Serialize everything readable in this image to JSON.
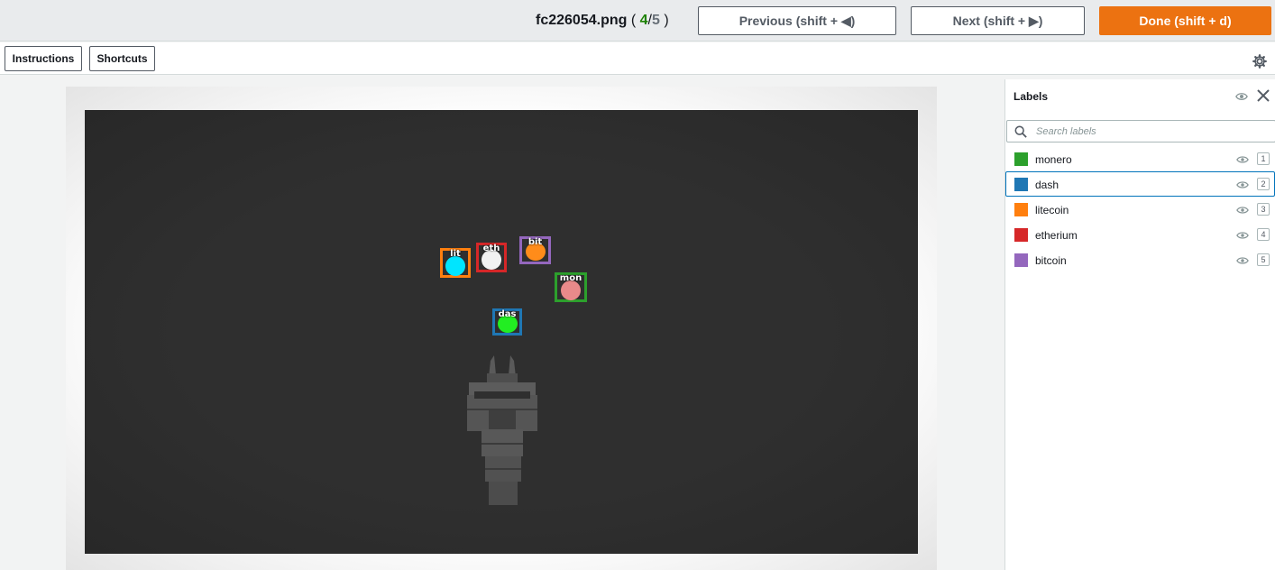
{
  "header": {
    "filename": "fc226054.png",
    "counter_open": " ( ",
    "current_index": "4",
    "slash": "/",
    "total": "5",
    "counter_close": " )",
    "previous_label": "Previous (shift + ◀)",
    "next_label": "Next (shift + ▶)",
    "done_label": "Done (shift + d)"
  },
  "toolbar": {
    "instructions_label": "Instructions",
    "shortcuts_label": "Shortcuts",
    "settings_icon": "gear-icon"
  },
  "canvas": {
    "boxes": [
      {
        "label": "litecoin",
        "text": "lit",
        "box_color": "#ff7f0e",
        "coin_color": "#00e5ff"
      },
      {
        "label": "etherium",
        "text": "eth",
        "box_color": "#d62728",
        "coin_color": "#f2f2f2"
      },
      {
        "label": "bitcoin",
        "text": "bit",
        "box_color": "#9467bd",
        "coin_color": "#ff8c1a"
      },
      {
        "label": "monero",
        "text": "mon",
        "box_color": "#2ca02c",
        "coin_color": "#e88a8a"
      },
      {
        "label": "dash",
        "text": "das",
        "box_color": "#1f77b4",
        "coin_color": "#22ee22"
      }
    ]
  },
  "panel": {
    "title": "Labels",
    "search_placeholder": "Search labels",
    "labels": [
      {
        "name": "monero",
        "color": "#2ca02c",
        "hotkey": "1"
      },
      {
        "name": "dash",
        "color": "#1f77b4",
        "hotkey": "2"
      },
      {
        "name": "litecoin",
        "color": "#ff7f0e",
        "hotkey": "3"
      },
      {
        "name": "etherium",
        "color": "#d62728",
        "hotkey": "4"
      },
      {
        "name": "bitcoin",
        "color": "#9467bd",
        "hotkey": "5"
      }
    ],
    "selected_label": "dash"
  }
}
